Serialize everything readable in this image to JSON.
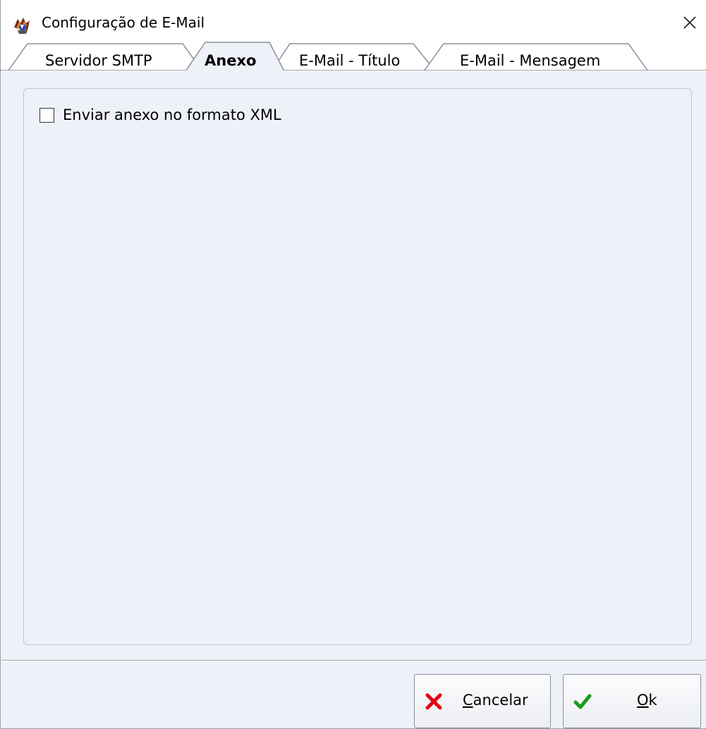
{
  "window": {
    "title": "Configuração de E-Mail",
    "app_icon": "app-logo-icon",
    "close_icon": "close-icon"
  },
  "tabs": [
    {
      "label": "Servidor SMTP",
      "active": false
    },
    {
      "label": "Anexo",
      "active": true
    },
    {
      "label": "E-Mail - Título",
      "active": false
    },
    {
      "label": "E-Mail - Mensagem",
      "active": false
    }
  ],
  "anexo": {
    "checkbox_label": "Enviar anexo no formato XML",
    "checked": false
  },
  "buttons": {
    "cancel": {
      "mnemonic": "C",
      "rest": "ancelar",
      "icon": "red-x-icon"
    },
    "ok": {
      "mnemonic": "O",
      "rest": "k",
      "icon": "green-check-icon"
    }
  },
  "colors": {
    "background": "#eef1f8",
    "cancel_icon": "#e3000f",
    "ok_icon": "#1a9a1a"
  }
}
